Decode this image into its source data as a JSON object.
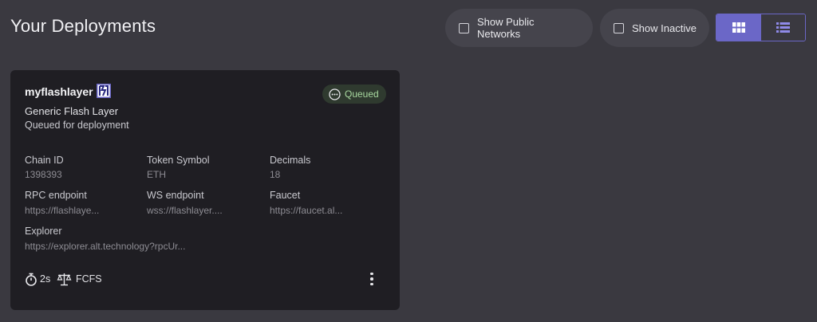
{
  "header": {
    "title": "Your Deployments"
  },
  "filters": {
    "show_public_label": "Show Public Networks",
    "show_inactive_label": "Show Inactive"
  },
  "view_toggle": {
    "active": "grid"
  },
  "deployment": {
    "name": "myflashlayer",
    "type": "Generic Flash Layer",
    "status_text": "Queued for deployment",
    "status_badge": "Queued",
    "fields": {
      "chain_id_label": "Chain ID",
      "chain_id": "1398393",
      "token_symbol_label": "Token Symbol",
      "token_symbol": "ETH",
      "decimals_label": "Decimals",
      "decimals": "18",
      "rpc_label": "RPC endpoint",
      "rpc": "https://flashlaye...",
      "ws_label": "WS endpoint",
      "ws": "wss://flashlayer....",
      "faucet_label": "Faucet",
      "faucet": "https://faucet.al...",
      "explorer_label": "Explorer",
      "explorer": "https://explorer.alt.technology?rpcUr..."
    },
    "footer": {
      "block_time": "2s",
      "sequencing": "FCFS"
    }
  },
  "colors": {
    "accent": "#6b67c7",
    "background": "#3a3940",
    "card": "#1f1e23",
    "status_green": "#a8d9a0"
  }
}
